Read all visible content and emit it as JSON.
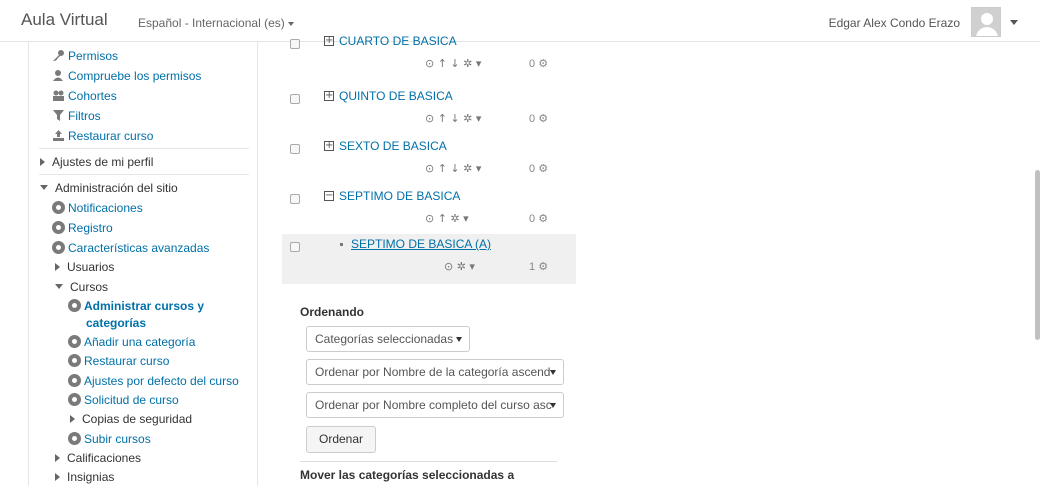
{
  "navbar": {
    "brand": "Aula Virtual",
    "language": "Español - Internacional (es)",
    "user_name": "Edgar Alex Condo Erazo"
  },
  "sidebar": {
    "items": [
      {
        "label": "Permisos",
        "icon": "key-icon"
      },
      {
        "label": "Compruebe los permisos",
        "icon": "user-check-icon"
      },
      {
        "label": "Cohortes",
        "icon": "users-icon"
      },
      {
        "label": "Filtros",
        "icon": "filter-icon"
      },
      {
        "label": "Restaurar curso",
        "icon": "upload-icon"
      },
      {
        "label": "Ajustes de mi perfil",
        "icon": "chevron-right-icon"
      },
      {
        "label": "Administración del sitio",
        "icon": "chevron-down-icon"
      },
      {
        "label": "Notificaciones",
        "icon": "gear-icon"
      },
      {
        "label": "Registro",
        "icon": "gear-icon"
      },
      {
        "label": "Características avanzadas",
        "icon": "gear-icon"
      },
      {
        "label": "Usuarios",
        "icon": "chevron-right-icon"
      },
      {
        "label": "Cursos",
        "icon": "chevron-down-icon"
      },
      {
        "label": "Administrar cursos y",
        "icon": "gear-icon"
      },
      {
        "label": "categorías",
        "icon": ""
      },
      {
        "label": "Añadir una categoría",
        "icon": "gear-icon"
      },
      {
        "label": "Restaurar curso",
        "icon": "gear-icon"
      },
      {
        "label": "Ajustes por defecto del curso",
        "icon": "gear-icon"
      },
      {
        "label": "Solicitud de curso",
        "icon": "gear-icon"
      },
      {
        "label": "Copias de seguridad",
        "icon": "chevron-right-icon"
      },
      {
        "label": "Subir cursos",
        "icon": "gear-icon"
      },
      {
        "label": "Calificaciones",
        "icon": "chevron-right-icon"
      },
      {
        "label": "Insignias",
        "icon": "chevron-right-icon"
      }
    ]
  },
  "categories": [
    {
      "name": "CUARTO DE BASICA",
      "expander": "+",
      "actions": "⊙ ↑ ↓ ✲ ▾",
      "count": "0"
    },
    {
      "name": "QUINTO DE BASICA",
      "expander": "+",
      "actions": "⊙ ↑ ↓ ✲ ▾",
      "count": "0"
    },
    {
      "name": "SEXTO DE BASICA",
      "expander": "+",
      "actions": "⊙ ↑ ↓ ✲ ▾",
      "count": "0"
    },
    {
      "name": "SEPTIMO DE BASICA",
      "expander": "−",
      "actions": "⊙ ↑ ✲ ▾",
      "count": "0"
    },
    {
      "name": "SEPTIMO DE BASICA (A)",
      "expander": "",
      "actions": "⊙ ✲ ▾",
      "count": "1"
    }
  ],
  "ordering": {
    "title": "Ordenando",
    "select_categories": "Categorías seleccionadas",
    "select_category_order": "Ordenar por Nombre de la categoría ascend",
    "select_course_order": "Ordenar por Nombre completo del curso asc",
    "button": "Ordenar",
    "move_title": "Mover las categorías seleccionadas a"
  },
  "colors": {
    "link": "#0070a8",
    "selected_row": "#f0f0f0"
  }
}
